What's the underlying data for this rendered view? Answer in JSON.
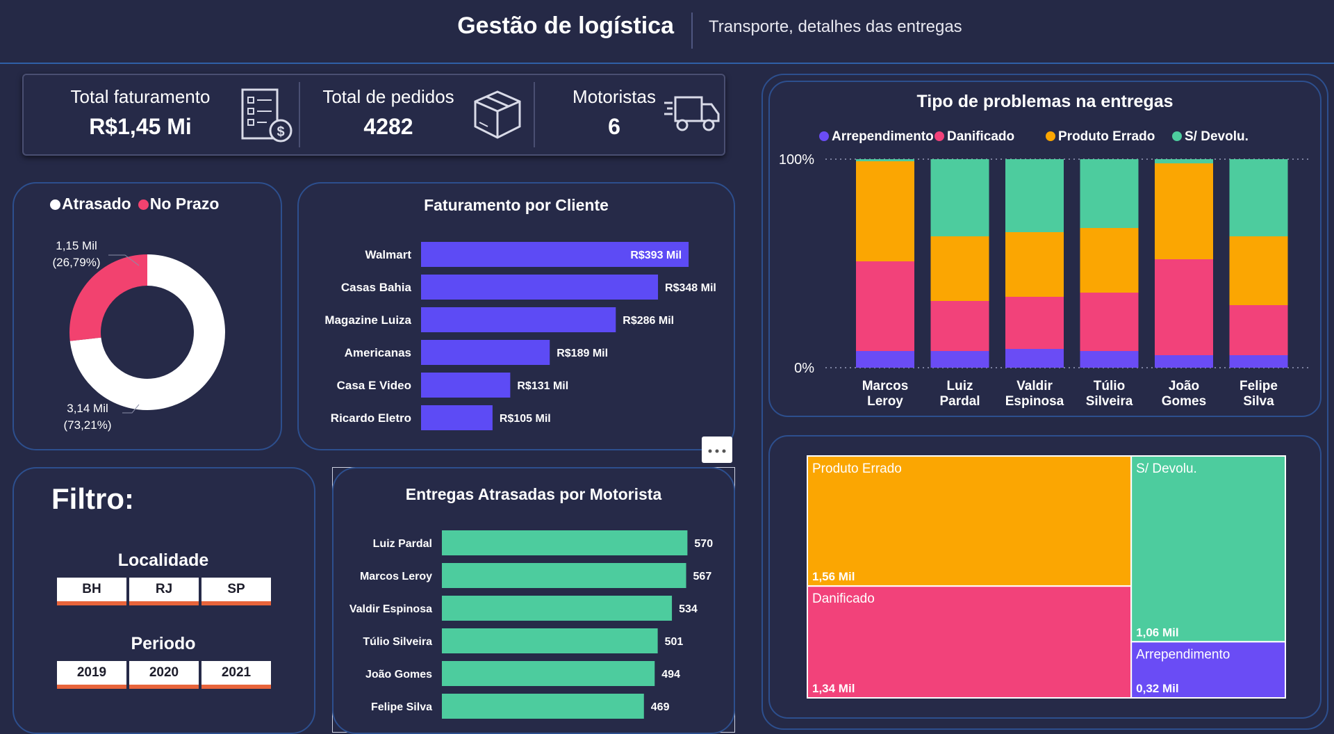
{
  "header": {
    "title": "Gestão de logística",
    "subtitle": "Transporte, detalhes das entregas"
  },
  "kpis": [
    {
      "label": "Total faturamento",
      "value": "R$1,45 Mi",
      "icon": "invoice-icon"
    },
    {
      "label": "Total de pedidos",
      "value": "4282",
      "icon": "package-icon"
    },
    {
      "label": "Motoristas",
      "value": "6",
      "icon": "truck-icon"
    }
  ],
  "colors": {
    "atrasado": "#ffffff",
    "no_prazo": "#f2426f",
    "arrependimento": "#6a4cf5",
    "danificado": "#f2427a",
    "produto_errado": "#fba602",
    "sem_devolucao": "#4dcc9e",
    "faturamento_bar": "#5d4bf5",
    "entregas_bar": "#4dcc9e"
  },
  "filter": {
    "title": "Filtro:",
    "localidade_label": "Localidade",
    "localidade": [
      "BH",
      "RJ",
      "SP"
    ],
    "periodo_label": "Periodo",
    "periodo": [
      "2019",
      "2020",
      "2021"
    ]
  },
  "chart_data": [
    {
      "type": "pie",
      "title": "",
      "legend": [
        "Atrasado",
        "No Prazo"
      ],
      "labels": [
        "Atrasado",
        "No Prazo"
      ],
      "values": [
        3.14,
        1.15
      ],
      "unit": "Mil",
      "data_labels": {
        "atrasado": [
          "3,14 Mil",
          "(73,21%)"
        ],
        "no_prazo": [
          "1,15 Mil",
          "(26,79%)"
        ]
      },
      "donut": true
    },
    {
      "type": "bar",
      "orientation": "horizontal",
      "title": "Faturamento por Cliente",
      "categories": [
        "Walmart",
        "Casas Bahia",
        "Magazine Luiza",
        "Americanas",
        "Casa E Video",
        "Ricardo Eletro"
      ],
      "values": [
        393,
        348,
        286,
        189,
        131,
        105
      ],
      "value_labels": [
        "R$393 Mil",
        "R$348 Mil",
        "R$286 Mil",
        "R$189 Mil",
        "R$131 Mil",
        "R$105 Mil"
      ],
      "xlim": [
        0,
        400
      ]
    },
    {
      "type": "bar",
      "orientation": "horizontal",
      "title": "Entregas Atrasadas por Motorista",
      "categories": [
        "Luiz Pardal",
        "Marcos Leroy",
        "Valdir Espinosa",
        "Túlio Silveira",
        "João Gomes",
        "Felipe Silva"
      ],
      "values": [
        570,
        567,
        534,
        501,
        494,
        469
      ],
      "value_labels": [
        "570",
        "567",
        "534",
        "501",
        "494",
        "469"
      ],
      "xlim": [
        0,
        600
      ]
    },
    {
      "type": "bar",
      "stacked": "100%",
      "title": "Tipo de problemas na entregas",
      "legend": [
        "Arrependimento",
        "Danificado",
        "Produto Errado",
        "S/ Devolu."
      ],
      "categories": [
        [
          "Marcos",
          "Leroy"
        ],
        [
          "Luiz",
          "Pardal"
        ],
        [
          "Valdir",
          "Espinosa"
        ],
        [
          "Túlio",
          "Silveira"
        ],
        [
          "João",
          "Gomes"
        ],
        [
          "Felipe",
          "Silva"
        ]
      ],
      "series": [
        {
          "name": "Arrependimento",
          "values": [
            8,
            8,
            9,
            8,
            6,
            6
          ]
        },
        {
          "name": "Danificado",
          "values": [
            43,
            24,
            25,
            28,
            46,
            24
          ]
        },
        {
          "name": "Produto Errado",
          "values": [
            48,
            31,
            31,
            31,
            46,
            33
          ]
        },
        {
          "name": "S/ Devolu.",
          "values": [
            1,
            37,
            35,
            33,
            2,
            37
          ]
        }
      ],
      "ylim": [
        0,
        100
      ],
      "yticks": [
        "0%",
        "100%"
      ],
      "grid": true,
      "legend_position": "top"
    },
    {
      "type": "treemap",
      "title": "",
      "items": [
        {
          "name": "Produto Errado",
          "value": 1.56,
          "label": "1,56 Mil"
        },
        {
          "name": "Danificado",
          "value": 1.34,
          "label": "1,34 Mil"
        },
        {
          "name": "S/ Devolu.",
          "value": 1.06,
          "label": "1,06 Mil"
        },
        {
          "name": "Arrependimento",
          "value": 0.32,
          "label": "0,32 Mil"
        }
      ]
    }
  ]
}
